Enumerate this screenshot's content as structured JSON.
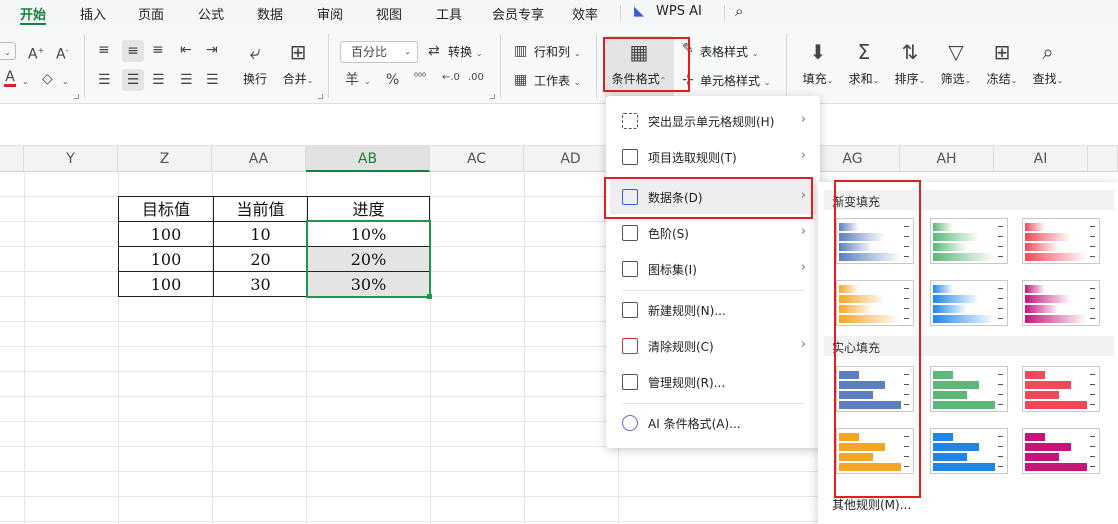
{
  "menu": {
    "tabs": [
      "开始",
      "插入",
      "页面",
      "公式",
      "数据",
      "审阅",
      "视图",
      "工具",
      "会员专享",
      "效率"
    ],
    "wps_ai": "WPS AI"
  },
  "ribbon": {
    "number_format": "百分比",
    "convert": "转换",
    "wrap": "换行",
    "merge": "合并",
    "currency_icon": "羊",
    "percent_icon": "%",
    "row_col": "行和列",
    "worksheet": "工作表",
    "cond_format": "条件格式",
    "table_style": "表格样式",
    "cell_style": "单元格样式",
    "fill": "填充",
    "sum": "求和",
    "sort": "排序",
    "filter": "筛选",
    "freeze": "冻结",
    "find": "查找"
  },
  "columns": [
    "Y",
    "Z",
    "AA",
    "AB",
    "AC",
    "AD",
    "AG",
    "AH",
    "AI"
  ],
  "table": {
    "headers": [
      "目标值",
      "当前值",
      "进度"
    ],
    "rows": [
      [
        "100",
        "10",
        "10%"
      ],
      [
        "100",
        "20",
        "20%"
      ],
      [
        "100",
        "30",
        "30%"
      ]
    ]
  },
  "cf_menu": {
    "items": [
      "突出显示单元格规则(H)",
      "项目选取规则(T)",
      "数据条(D)",
      "色阶(S)",
      "图标集(I)",
      "新建规则(N)...",
      "清除规则(C)",
      "管理规则(R)...",
      "AI 条件格式(A)..."
    ]
  },
  "databar_submenu": {
    "gradient_title": "渐变填充",
    "solid_title": "实心填充",
    "more_rules": "其他规则(M)...",
    "colors": [
      "#5b7fbf",
      "#5bb877",
      "#f04a58",
      "#f5a623",
      "#1f86e6",
      "#c6147a"
    ]
  }
}
